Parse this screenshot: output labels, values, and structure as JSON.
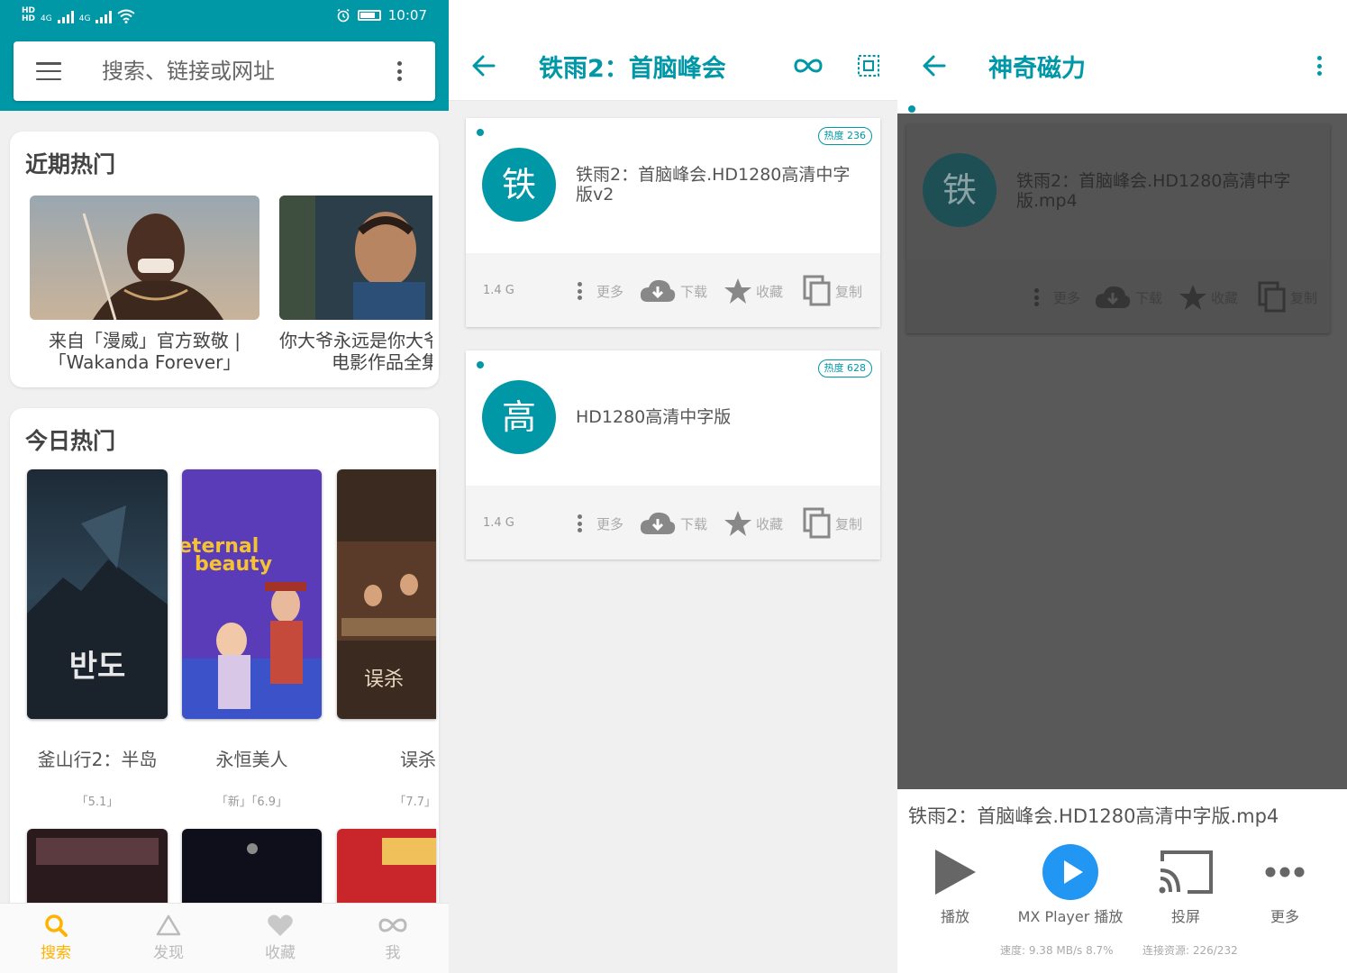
{
  "colors": {
    "accent": "#0097a7",
    "active_tab": "#ffb300",
    "dim_overlay": "#595959",
    "play_blue": "#2196f3"
  },
  "panel1": {
    "status_bar": {
      "net1": "4G",
      "net2": "4G",
      "time": "10:07",
      "icons": [
        "hd-icon",
        "signal-icon",
        "wifi-icon",
        "alarm-icon",
        "battery-icon"
      ]
    },
    "search": {
      "placeholder": "搜索、链接或网址"
    },
    "recent_section": {
      "title": "近期热门",
      "items": [
        {
          "caption_line1": "来自「漫威」官方致敬 |",
          "caption_line2": "「Wakanda Forever」"
        },
        {
          "caption_line1": "你大爷永远是你大爷",
          "caption_line2": "电影作品全集"
        }
      ]
    },
    "today_section": {
      "title": "今日热门",
      "items": [
        {
          "title": "釜山行2：半岛",
          "date": "「5.1」",
          "poster_text": "반도"
        },
        {
          "title": "永恒美人",
          "date": "「新」「6.9」",
          "poster_text_line1": "eternal",
          "poster_text_line2": "beauty"
        },
        {
          "title": "误杀",
          "date": "「7.7」",
          "poster_text": "误杀"
        }
      ]
    },
    "bottom_nav": [
      {
        "label": "搜索",
        "icon": "search-icon",
        "active": true
      },
      {
        "label": "发现",
        "icon": "triangle-icon",
        "active": false
      },
      {
        "label": "收藏",
        "icon": "heart-icon",
        "active": false
      },
      {
        "label": "我",
        "icon": "infinity-icon",
        "active": false
      }
    ]
  },
  "panel2": {
    "title": "铁雨2：首脑峰会",
    "results": [
      {
        "avatar": "铁",
        "name": "铁雨2：首脑峰会.HD1280高清中字版v2",
        "heat": "热度 236",
        "size": "1.4 G"
      },
      {
        "avatar": "高",
        "name": "HD1280高清中字版",
        "heat": "热度 628",
        "size": "1.4 G"
      }
    ],
    "actions": {
      "more": "更多",
      "download": "下载",
      "favorite": "收藏",
      "copy": "复制"
    }
  },
  "panel3": {
    "title": "神奇磁力",
    "result": {
      "avatar": "铁",
      "name": "铁雨2：首脑峰会.HD1280高清中字版.mp4"
    },
    "actions": {
      "more": "更多",
      "download": "下载",
      "favorite": "收藏",
      "copy": "复制"
    },
    "sheet": {
      "file_name": "铁雨2：首脑峰会.HD1280高清中字版.mp4",
      "buttons": [
        {
          "label": "播放",
          "icon": "play-icon"
        },
        {
          "label": "MX Player 播放",
          "icon": "mx-player-icon"
        },
        {
          "label": "投屏",
          "icon": "cast-icon"
        },
        {
          "label": "更多",
          "icon": "more-horizontal-icon"
        }
      ],
      "speed": "速度: 9.38 MB/s  8.7%",
      "sources": "连接资源: 226/232"
    }
  }
}
